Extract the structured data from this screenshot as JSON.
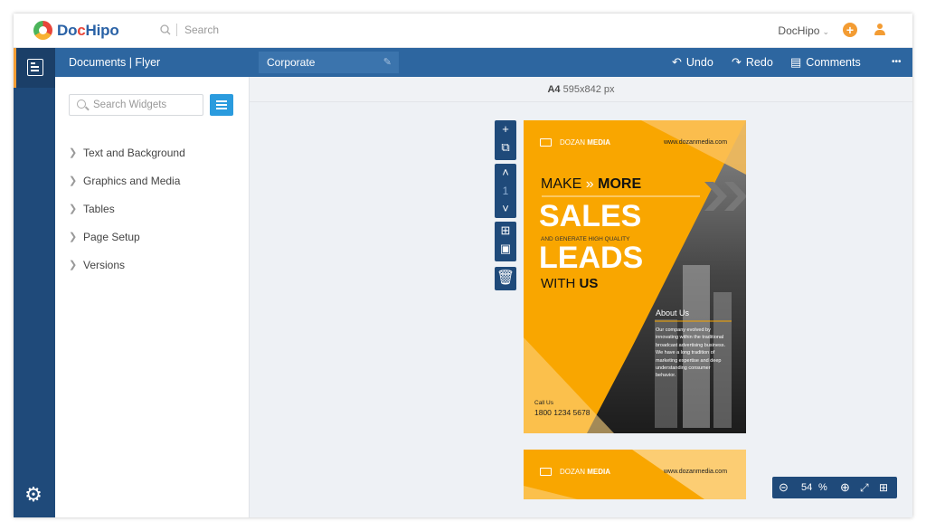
{
  "brand": {
    "part1": "Do",
    "part2": "c",
    "part3": "Hipo"
  },
  "topbar": {
    "search_placeholder": "Search",
    "account_label": "DocHipo"
  },
  "panel": {
    "title": "Documents | Flyer",
    "widget_search_placeholder": "Search Widgets",
    "items": [
      {
        "label": "Text and Background"
      },
      {
        "label": "Graphics and Media"
      },
      {
        "label": "Tables"
      },
      {
        "label": "Page Setup"
      },
      {
        "label": "Versions"
      }
    ]
  },
  "toolbar": {
    "doc_name": "Corporate",
    "undo": "Undo",
    "redo": "Redo",
    "comments": "Comments",
    "more": "•••"
  },
  "page_size": {
    "name": "A4",
    "dims": "595x842 px"
  },
  "page_tools": {
    "page_number": "1"
  },
  "flyer": {
    "brand_light": "DOZAN",
    "brand_bold": "MEDIA",
    "website": "www.dozanmedia.com",
    "make": "MAKE",
    "more": "MORE",
    "sales": "SALES",
    "generate": "AND GENERATE HIGH QUALITY",
    "leads": "LEADS",
    "with": "WITH",
    "us": "US",
    "about_title": "About Us",
    "about_lines": [
      "Our company evolved by",
      "innovating within the traditional",
      "broadcast advertising business.",
      "We have a long tradition of",
      "marketing expertise and deep",
      "understanding consumer",
      "behavior."
    ],
    "call_label": "Call Us",
    "phone": "1800 1234 5678"
  },
  "zoom": {
    "value": "54",
    "unit": "%"
  },
  "colors": {
    "accent": "#f39c33",
    "navy": "#1f4a7a",
    "toolbar": "#2d66a0",
    "flyer_orange": "#f9a600",
    "button_blue": "#2a9bde"
  }
}
